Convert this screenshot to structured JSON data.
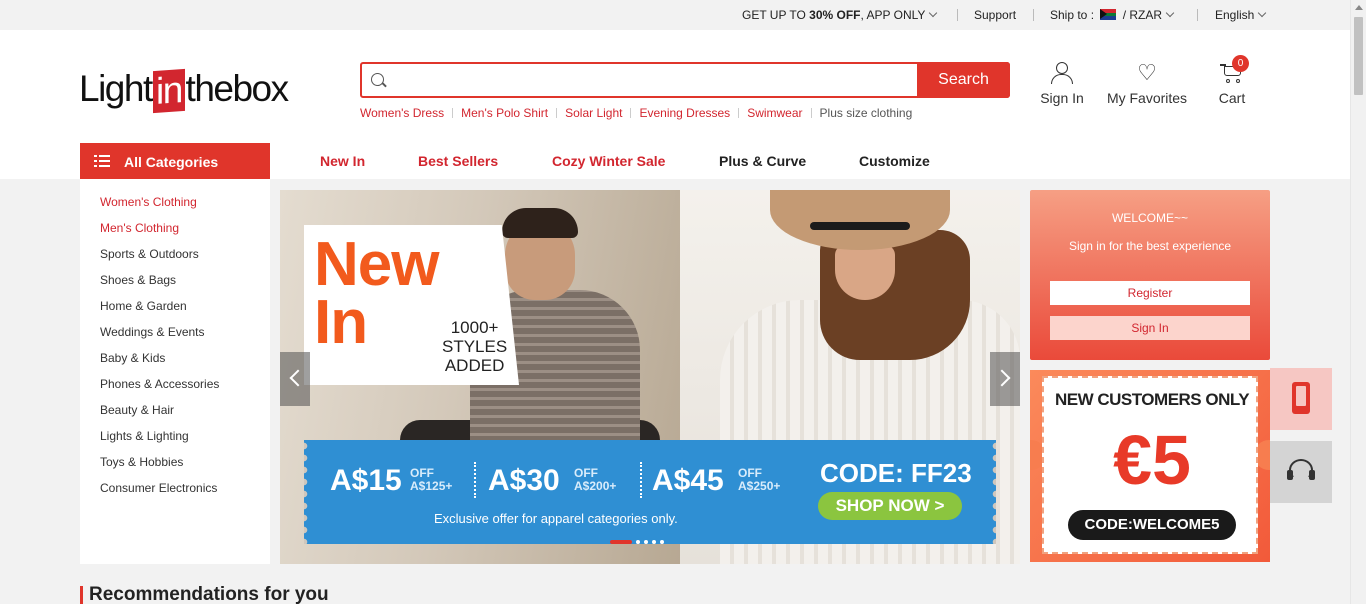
{
  "topbar": {
    "promo_prefix": "GET UP TO ",
    "promo_bold": "30% OFF",
    "promo_suffix": ", APP ONLY",
    "support": "Support",
    "ship_to": "Ship to :",
    "currency": "/ RZAR",
    "language": "English"
  },
  "header": {
    "logo_left": "Light",
    "logo_mid": "in",
    "logo_right": "thebox",
    "search_placeholder": "",
    "search_button": "Search",
    "hot_searches": [
      "Women's Dress",
      "Men's Polo Shirt",
      "Solar Light",
      "Evening Dresses",
      "Swimwear"
    ],
    "hot_search_plain": "Plus size clothing",
    "sign_in": "Sign In",
    "favorites": "My Favorites",
    "cart": "Cart",
    "cart_count": "0"
  },
  "nav": {
    "all_categories": "All Categories",
    "links": [
      "New In",
      "Best Sellers",
      "Cozy Winter Sale",
      "Plus & Curve",
      "Customize"
    ]
  },
  "sidebar": {
    "categories": [
      "Women's Clothing",
      "Men's Clothing",
      "Sports & Outdoors",
      "Shoes & Bags",
      "Home & Garden",
      "Weddings & Events",
      "Baby & Kids",
      "Phones & Accessories",
      "Beauty & Hair",
      "Lights & Lighting",
      "Toys & Hobbies",
      "Consumer Electronics"
    ]
  },
  "banner": {
    "new_line1": "New",
    "new_line2": "In",
    "styles_line1": "1000+",
    "styles_line2": "STYLES",
    "styles_line3": "ADDED",
    "offers": [
      {
        "amount": "A$15",
        "off": "OFF",
        "min": "A$125+"
      },
      {
        "amount": "A$30",
        "off": "OFF",
        "min": "A$200+"
      },
      {
        "amount": "A$45",
        "off": "OFF",
        "min": "A$250+"
      }
    ],
    "code": "CODE: FF23",
    "shop_now": "SHOP NOW >",
    "exclusive": "Exclusive offer for apparel categories only."
  },
  "welcome": {
    "title": "WELCOME~~",
    "subtitle": "Sign in for the best experience",
    "register": "Register",
    "sign_in": "Sign In"
  },
  "coupon": {
    "headline": "NEW CUSTOMERS ONLY",
    "amount": "€5",
    "code": "CODE:WELCOME5"
  },
  "recommendations": {
    "title": "Recommendations for you"
  },
  "colors": {
    "brand_red": "#e0352b",
    "promo_blue": "#2f8fd3",
    "shop_green": "#8bc53f"
  },
  "icons": [
    "search-icon",
    "user-icon",
    "heart-icon",
    "cart-icon",
    "list-icon",
    "phone-icon",
    "headset-icon",
    "chevron-left-icon",
    "chevron-right-icon"
  ]
}
